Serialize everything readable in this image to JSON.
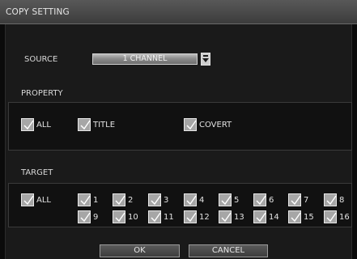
{
  "window": {
    "title": "COPY SETTING"
  },
  "source": {
    "label": "SOURCE",
    "value": "1 CHANNEL",
    "dropdown_icon": "chevron-down-icon"
  },
  "property": {
    "label": "PROPERTY",
    "options": [
      {
        "label": "ALL",
        "checked": true
      },
      {
        "label": "TITLE",
        "checked": true
      },
      {
        "label": "COVERT",
        "checked": true
      }
    ]
  },
  "target": {
    "label": "TARGET",
    "all": {
      "label": "ALL",
      "checked": true
    },
    "channels": [
      "1",
      "2",
      "3",
      "4",
      "5",
      "6",
      "7",
      "8",
      "9",
      "10",
      "11",
      "12",
      "13",
      "14",
      "15",
      "16"
    ]
  },
  "buttons": {
    "ok": "OK",
    "cancel": "CANCEL"
  },
  "colors": {
    "checkbox_fill": "#a6a6a6",
    "title_bar": "#4a4a4a",
    "background": "#1a1a1a"
  }
}
